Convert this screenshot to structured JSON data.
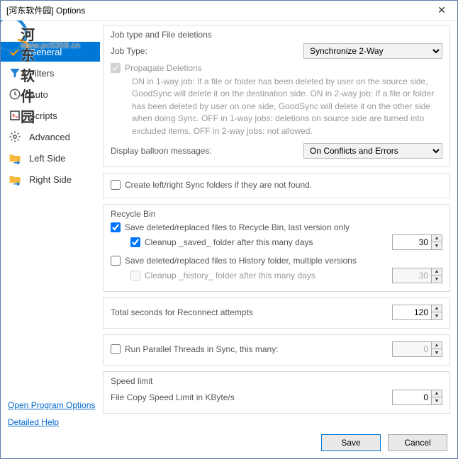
{
  "window": {
    "title": "[河东软件园] Options",
    "close_symbol": "✕"
  },
  "watermark": {
    "text1": "河东软件园",
    "text2": "www.pc0359.cn"
  },
  "sidebar": {
    "items": [
      {
        "key": "general",
        "label": "General",
        "active": true
      },
      {
        "key": "filters",
        "label": "Filters",
        "active": false
      },
      {
        "key": "auto",
        "label": "Auto",
        "active": false
      },
      {
        "key": "scripts",
        "label": "Scripts",
        "active": false
      },
      {
        "key": "advanced",
        "label": "Advanced",
        "active": false
      },
      {
        "key": "leftside",
        "label": "Left Side",
        "active": false
      },
      {
        "key": "rightside",
        "label": "Right Side",
        "active": false
      }
    ]
  },
  "section_job": {
    "title": "Job type and File deletions",
    "jobtype_label": "Job Type:",
    "jobtype_value": "Synchronize 2-Way",
    "propagate_label": "Propagate Deletions",
    "propagate_checked": true,
    "propagate_disabled": true,
    "propagate_desc": "ON in 1-way job: If a file or folder has been deleted by user on the source side, GoodSync will delete it on the destination side.  ON in 2-way job: If a file or folder has been deleted by user on one side, GoodSync will delete it on the other side when doing Sync.  OFF in 1-way jobs: deletions on source side are turned into excluded items. OFF in 2-way jobs: not allowed.",
    "display_label": "Display balloon messages:",
    "display_value": "On Conflicts and Errors"
  },
  "section_create": {
    "text": "Create left/right Sync folders if they are not found.",
    "checked": false
  },
  "section_recycle": {
    "title": "Recycle Bin",
    "opt1": {
      "text": "Save deleted/replaced files to Recycle Bin, last version only",
      "checked": true
    },
    "opt1a": {
      "text": "Cleanup _saved_ folder after this many days",
      "checked": true,
      "value": "30",
      "enabled": true
    },
    "opt2": {
      "text": "Save deleted/replaced files to History folder, multiple versions",
      "checked": false
    },
    "opt2a": {
      "text": "Cleanup _history_ folder after this many days",
      "checked": false,
      "value": "30",
      "enabled": false
    }
  },
  "section_reconnect": {
    "label": "Total seconds for Reconnect attempts",
    "value": "120"
  },
  "section_parallel": {
    "label": "Run Parallel Threads in Sync, this many:",
    "checked": false,
    "value": "0",
    "enabled": false
  },
  "section_speed": {
    "title": "Speed limit",
    "label": "File Copy Speed Limit in KByte/s",
    "value": "0"
  },
  "footer": {
    "link1": "Open Program Options",
    "link2": "Detailed Help",
    "save": "Save",
    "cancel": "Cancel"
  }
}
